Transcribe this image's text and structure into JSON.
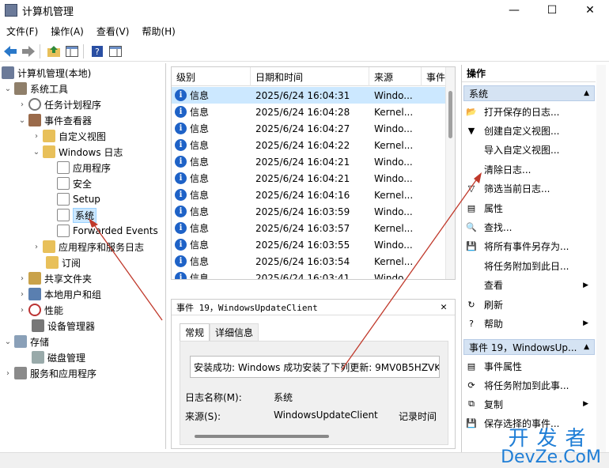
{
  "window": {
    "title": "计算机管理",
    "minimize": "—",
    "maximize": "☐",
    "close": "✕"
  },
  "menu": [
    "文件(F)",
    "操作(A)",
    "查看(V)",
    "帮助(H)"
  ],
  "tree": {
    "root": "计算机管理(本地)",
    "system_tools": "系统工具",
    "task_scheduler": "任务计划程序",
    "event_viewer": "事件查看器",
    "custom_views": "自定义视图",
    "windows_logs": "Windows 日志",
    "application": "应用程序",
    "security": "安全",
    "setup": "Setup",
    "system": "系统",
    "forwarded": "Forwarded Events",
    "app_service_logs": "应用程序和服务日志",
    "subscriptions": "订阅",
    "shared_folders": "共享文件夹",
    "local_users": "本地用户和组",
    "performance": "性能",
    "device_manager": "设备管理器",
    "storage": "存储",
    "disk_mgmt": "磁盘管理",
    "services_apps": "服务和应用程序"
  },
  "grid": {
    "headers": [
      "级别",
      "日期和时间",
      "来源",
      "事件"
    ],
    "rows": [
      {
        "level": "信息",
        "datetime": "2025/6/24 16:04:31",
        "source": "Windo..."
      },
      {
        "level": "信息",
        "datetime": "2025/6/24 16:04:28",
        "source": "Kernel..."
      },
      {
        "level": "信息",
        "datetime": "2025/6/24 16:04:27",
        "source": "Windo..."
      },
      {
        "level": "信息",
        "datetime": "2025/6/24 16:04:22",
        "source": "Kernel..."
      },
      {
        "level": "信息",
        "datetime": "2025/6/24 16:04:21",
        "source": "Windo..."
      },
      {
        "level": "信息",
        "datetime": "2025/6/24 16:04:21",
        "source": "Windo..."
      },
      {
        "level": "信息",
        "datetime": "2025/6/24 16:04:16",
        "source": "Kernel..."
      },
      {
        "level": "信息",
        "datetime": "2025/6/24 16:03:59",
        "source": "Windo..."
      },
      {
        "level": "信息",
        "datetime": "2025/6/24 16:03:57",
        "source": "Kernel..."
      },
      {
        "level": "信息",
        "datetime": "2025/6/24 16:03:55",
        "source": "Windo..."
      },
      {
        "level": "信息",
        "datetime": "2025/6/24 16:03:54",
        "source": "Kernel..."
      },
      {
        "level": "信息",
        "datetime": "2025/6/24 16:03:41",
        "source": "Windo..."
      }
    ]
  },
  "detail": {
    "header": "事件 19，WindowsUpdateClient",
    "close": "✕",
    "tab_general": "常规",
    "tab_details": "详细信息",
    "message": "安装成功: Windows 成功安装了下列更新: 9MV0B5HZVK",
    "log_name_label": "日志名称(M):",
    "log_name_value": "系统",
    "source_label": "来源(S):",
    "source_value": "WindowsUpdateClient",
    "logged_label": "记录时间"
  },
  "actions": {
    "title": "操作",
    "section_system": "系统",
    "items_system": [
      "打开保存的日志...",
      "创建自定义视图...",
      "导入自定义视图...",
      "清除日志...",
      "筛选当前日志...",
      "属性",
      "查找...",
      "将所有事件另存为...",
      "将任务附加到此日...",
      "查看",
      "刷新",
      "帮助"
    ],
    "section_event": "事件 19，WindowsUp...",
    "items_event": [
      "事件属性",
      "将任务附加到此事...",
      "复制",
      "保存选择的事件..."
    ]
  },
  "watermark": {
    "cn": "开发者",
    "en": "DevZe.CoM"
  }
}
